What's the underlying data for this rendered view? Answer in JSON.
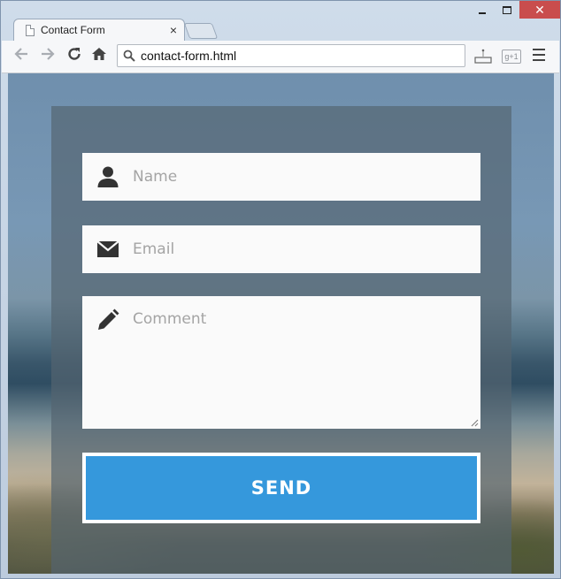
{
  "browser": {
    "tab": {
      "title": "Contact Form",
      "close_glyph": "×"
    },
    "window_controls": {
      "close_glyph": "✕"
    },
    "address_bar": {
      "url": "contact-form.html"
    },
    "gplus_label": "g+1",
    "icons": {
      "back": "back-arrow-icon",
      "forward": "forward-arrow-icon",
      "reload": "reload-icon",
      "home": "home-icon",
      "search": "search-icon",
      "menu": "hamburger-menu-icon"
    }
  },
  "form": {
    "name_placeholder": "Name",
    "email_placeholder": "Email",
    "comment_placeholder": "Comment",
    "send_label": "SEND",
    "icons": {
      "name": "user-icon",
      "email": "envelope-icon",
      "comment": "pencil-icon"
    }
  },
  "colors": {
    "send_button": "#3598dc",
    "field_background": "#fafafa",
    "icon": "#333333",
    "placeholder": "#a4a4a4",
    "window_close": "#c94d4d"
  }
}
